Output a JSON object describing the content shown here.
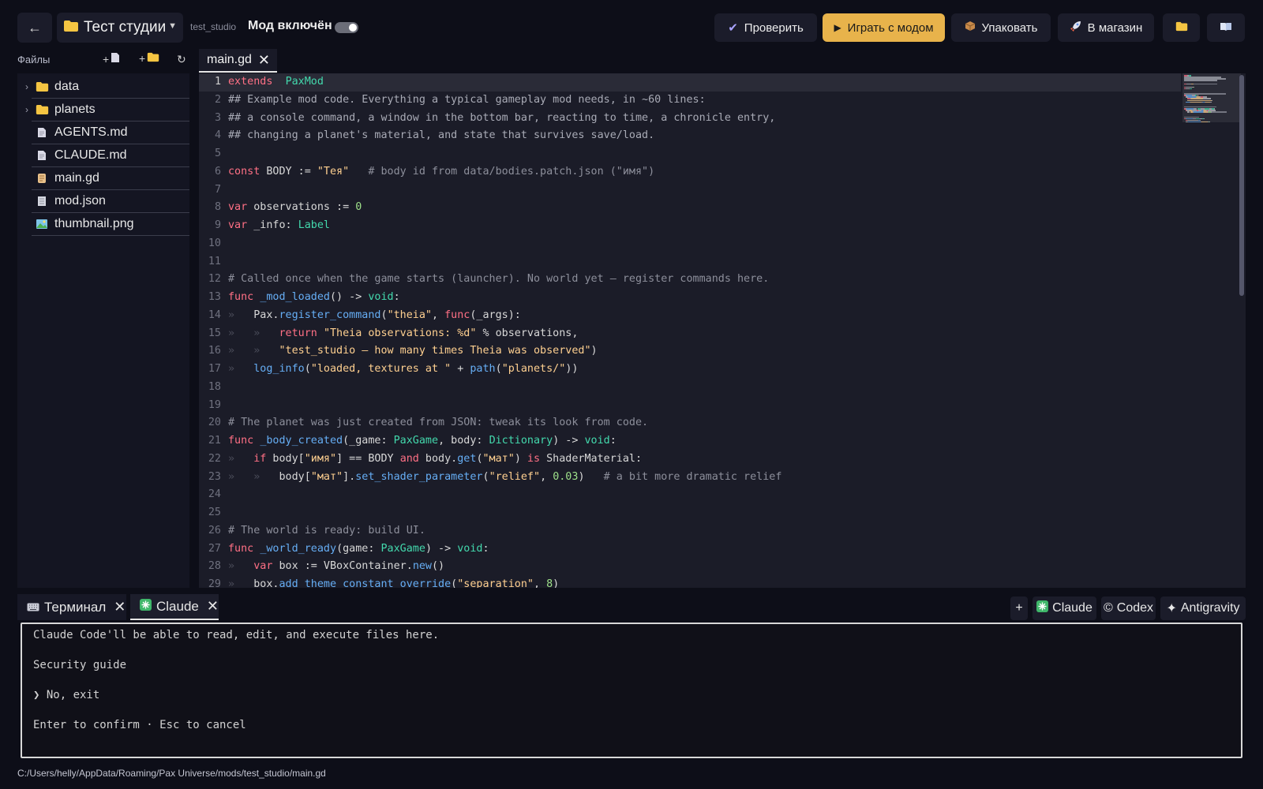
{
  "topbar": {
    "back_icon": "arrow-left-icon",
    "studio_name": "Тест студии",
    "studio_id": "test_studio",
    "mod_enabled_label": "Мод включён",
    "mod_enabled": true,
    "buttons": {
      "check": "Проверить",
      "play": "Играть с модом",
      "pack": "Упаковать",
      "store": "В магазин"
    },
    "accent_color": "#e8b34b"
  },
  "sidebar": {
    "title": "Файлы",
    "items": [
      {
        "label": "data",
        "kind": "folder"
      },
      {
        "label": "planets",
        "kind": "folder"
      },
      {
        "label": "AGENTS.md",
        "kind": "doc"
      },
      {
        "label": "CLAUDE.md",
        "kind": "doc"
      },
      {
        "label": "main.gd",
        "kind": "script"
      },
      {
        "label": "mod.json",
        "kind": "json"
      },
      {
        "label": "thumbnail.png",
        "kind": "image"
      }
    ]
  },
  "editor": {
    "tab_label": "main.gd",
    "active_line": 1,
    "lines": [
      {
        "n": "1",
        "t": [
          [
            "kw",
            "extends"
          ],
          [
            "",
            "  "
          ],
          [
            "ty",
            "PaxMod"
          ]
        ]
      },
      {
        "n": "2",
        "t": [
          [
            "doc",
            "## Example mod code. Everything a typical gameplay mod needs, in ~60 lines:"
          ]
        ]
      },
      {
        "n": "3",
        "t": [
          [
            "doc",
            "## a console command, a window in the bottom bar, reacting to time, a chronicle entry,"
          ]
        ]
      },
      {
        "n": "4",
        "t": [
          [
            "doc",
            "## changing a planet's material, and state that survives save/load."
          ]
        ]
      },
      {
        "n": "5",
        "t": []
      },
      {
        "n": "6",
        "t": [
          [
            "kw",
            "const"
          ],
          [
            "",
            " BODY := "
          ],
          [
            "st",
            "\"Тея\""
          ],
          [
            "cm",
            "   # body id from data/bodies.patch.json (\"имя\")"
          ]
        ]
      },
      {
        "n": "7",
        "t": []
      },
      {
        "n": "8",
        "t": [
          [
            "kw",
            "var"
          ],
          [
            "",
            " observations := "
          ],
          [
            "nu",
            "0"
          ]
        ]
      },
      {
        "n": "9",
        "t": [
          [
            "kw",
            "var"
          ],
          [
            "",
            " _info: "
          ],
          [
            "ty",
            "Label"
          ]
        ]
      },
      {
        "n": "10",
        "t": []
      },
      {
        "n": "11",
        "t": []
      },
      {
        "n": "12",
        "t": [
          [
            "cm",
            "# Called once when the game starts (launcher). No world yet — register commands here."
          ]
        ]
      },
      {
        "n": "13",
        "t": [
          [
            "kw",
            "func"
          ],
          [
            "",
            " "
          ],
          [
            "fn",
            "_mod_loaded"
          ],
          [
            "",
            "() -> "
          ],
          [
            "ty",
            "void"
          ],
          [
            "",
            ":"
          ]
        ]
      },
      {
        "n": "14",
        "t": [
          [
            "tab",
            "»   "
          ],
          [
            "",
            "Pax."
          ],
          [
            "fn",
            "register_command"
          ],
          [
            "",
            "("
          ],
          [
            "st",
            "\"theia\""
          ],
          [
            "",
            ", "
          ],
          [
            "kw",
            "func"
          ],
          [
            "",
            "(_args):"
          ]
        ]
      },
      {
        "n": "15",
        "t": [
          [
            "tab",
            "»   »   "
          ],
          [
            "kw",
            "return"
          ],
          [
            "",
            " "
          ],
          [
            "st",
            "\"Theia observations: %d\""
          ],
          [
            "",
            " % observations,"
          ]
        ]
      },
      {
        "n": "16",
        "t": [
          [
            "tab",
            "»   »   "
          ],
          [
            "st",
            "\"test_studio — how many times Theia was observed\""
          ],
          [
            "",
            ")"
          ]
        ]
      },
      {
        "n": "17",
        "t": [
          [
            "tab",
            "»   "
          ],
          [
            "fn",
            "log_info"
          ],
          [
            "",
            "("
          ],
          [
            "st",
            "\"loaded, textures at \""
          ],
          [
            "",
            " + "
          ],
          [
            "fn",
            "path"
          ],
          [
            "",
            "("
          ],
          [
            "st",
            "\"planets/\""
          ],
          [
            "",
            "))"
          ]
        ]
      },
      {
        "n": "18",
        "t": []
      },
      {
        "n": "19",
        "t": []
      },
      {
        "n": "20",
        "t": [
          [
            "cm",
            "# The planet was just created from JSON: tweak its look from code."
          ]
        ]
      },
      {
        "n": "21",
        "t": [
          [
            "kw",
            "func"
          ],
          [
            "",
            " "
          ],
          [
            "fn",
            "_body_created"
          ],
          [
            "",
            "(_game: "
          ],
          [
            "ty",
            "PaxGame"
          ],
          [
            "",
            ", body: "
          ],
          [
            "ty",
            "Dictionary"
          ],
          [
            "",
            ") -> "
          ],
          [
            "ty",
            "void"
          ],
          [
            "",
            ":"
          ]
        ]
      },
      {
        "n": "22",
        "t": [
          [
            "tab",
            "»   "
          ],
          [
            "kw",
            "if"
          ],
          [
            "",
            " body["
          ],
          [
            "st",
            "\"имя\""
          ],
          [
            "",
            "] == BODY "
          ],
          [
            "kw",
            "and"
          ],
          [
            "",
            " body."
          ],
          [
            "fn",
            "get"
          ],
          [
            "",
            "("
          ],
          [
            "st",
            "\"мат\""
          ],
          [
            "",
            ") "
          ],
          [
            "kw",
            "is"
          ],
          [
            "",
            " ShaderMaterial:"
          ]
        ]
      },
      {
        "n": "23",
        "t": [
          [
            "tab",
            "»   »   "
          ],
          [
            "",
            "body["
          ],
          [
            "st",
            "\"мат\""
          ],
          [
            "",
            "]."
          ],
          [
            "fn",
            "set_shader_parameter"
          ],
          [
            "",
            "("
          ],
          [
            "st",
            "\"relief\""
          ],
          [
            "",
            ", "
          ],
          [
            "nu",
            "0.03"
          ],
          [
            "",
            ")"
          ],
          [
            "cm",
            "   # a bit more dramatic relief"
          ]
        ]
      },
      {
        "n": "24",
        "t": []
      },
      {
        "n": "25",
        "t": []
      },
      {
        "n": "26",
        "t": [
          [
            "cm",
            "# The world is ready: build UI."
          ]
        ]
      },
      {
        "n": "27",
        "t": [
          [
            "kw",
            "func"
          ],
          [
            "",
            " "
          ],
          [
            "fn",
            "_world_ready"
          ],
          [
            "",
            "(game: "
          ],
          [
            "ty",
            "PaxGame"
          ],
          [
            "",
            ") -> "
          ],
          [
            "ty",
            "void"
          ],
          [
            "",
            ":"
          ]
        ]
      },
      {
        "n": "28",
        "t": [
          [
            "tab",
            "»   "
          ],
          [
            "kw",
            "var"
          ],
          [
            "",
            " box := VBoxContainer."
          ],
          [
            "fn",
            "new"
          ],
          [
            "",
            "()"
          ]
        ]
      },
      {
        "n": "29",
        "t": [
          [
            "tab",
            "»   "
          ],
          [
            "",
            "box."
          ],
          [
            "fn",
            "add_theme_constant_override"
          ],
          [
            "",
            "("
          ],
          [
            "st",
            "\"separation\""
          ],
          [
            "",
            ", "
          ],
          [
            "nu",
            "8"
          ],
          [
            "",
            ")"
          ]
        ]
      }
    ]
  },
  "bottom": {
    "tabs": [
      {
        "label": "Терминал"
      },
      {
        "label": "Claude"
      }
    ],
    "add_label": "+",
    "agents": [
      "Claude",
      "Codex",
      "Antigravity"
    ],
    "terminal_lines": [
      "Claude Code'll be able to read, edit, and execute files here.",
      "Security guide",
      "❯ No, exit",
      "Enter to confirm · Esc to cancel"
    ]
  },
  "status": {
    "path": "C:/Users/helly/AppData/Roaming/Pax Universe/mods/test_studio/main.gd"
  }
}
